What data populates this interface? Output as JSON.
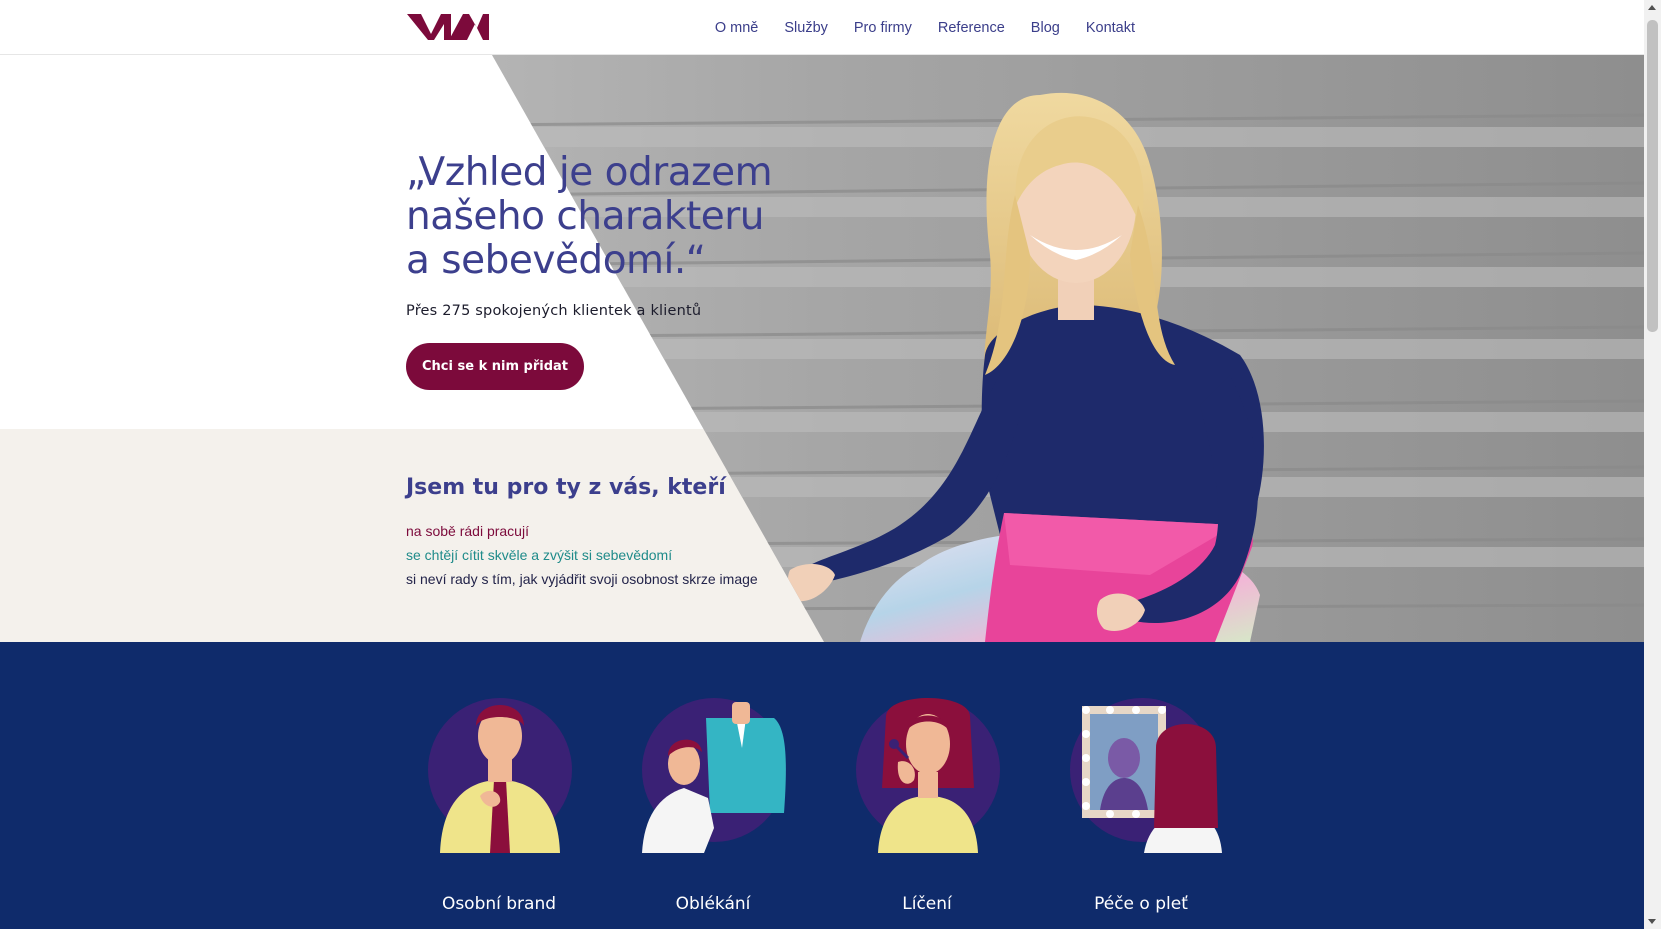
{
  "header": {
    "logo_alt": "VM",
    "nav": [
      "O mně",
      "Služby",
      "Pro firmy",
      "Reference",
      "Blog",
      "Kontakt"
    ]
  },
  "hero": {
    "title_lines": [
      "„Vzhled je odrazem",
      "našeho charakteru",
      "a sebevědomí.“"
    ],
    "subtitle": "Přes 275 spokojených klientek a klientů",
    "cta_label": "Chci se k nim přidat"
  },
  "intro": {
    "title": "Jsem tu pro ty z vás, kteří",
    "lines": [
      "na sobě rádi pracují",
      "se chtějí cítit skvěle a zvýšit si sebevědomí",
      "si neví rady s tím, jak vyjádřit svoji osobnost skrze image"
    ]
  },
  "services": [
    {
      "label": "Osobní brand",
      "icon": "personal-brand-icon"
    },
    {
      "label": "Oblékání",
      "icon": "dressing-icon"
    },
    {
      "label": "Líčení",
      "icon": "makeup-icon"
    },
    {
      "label": "Péče o pleť",
      "icon": "skincare-icon"
    }
  ],
  "colors": {
    "brand": "#7c0a3b",
    "heading": "#3c3f8d",
    "accent_teal": "#1f8b8a",
    "services_bg": "#0f2b6b",
    "intro_bg": "#f4f1ec"
  }
}
